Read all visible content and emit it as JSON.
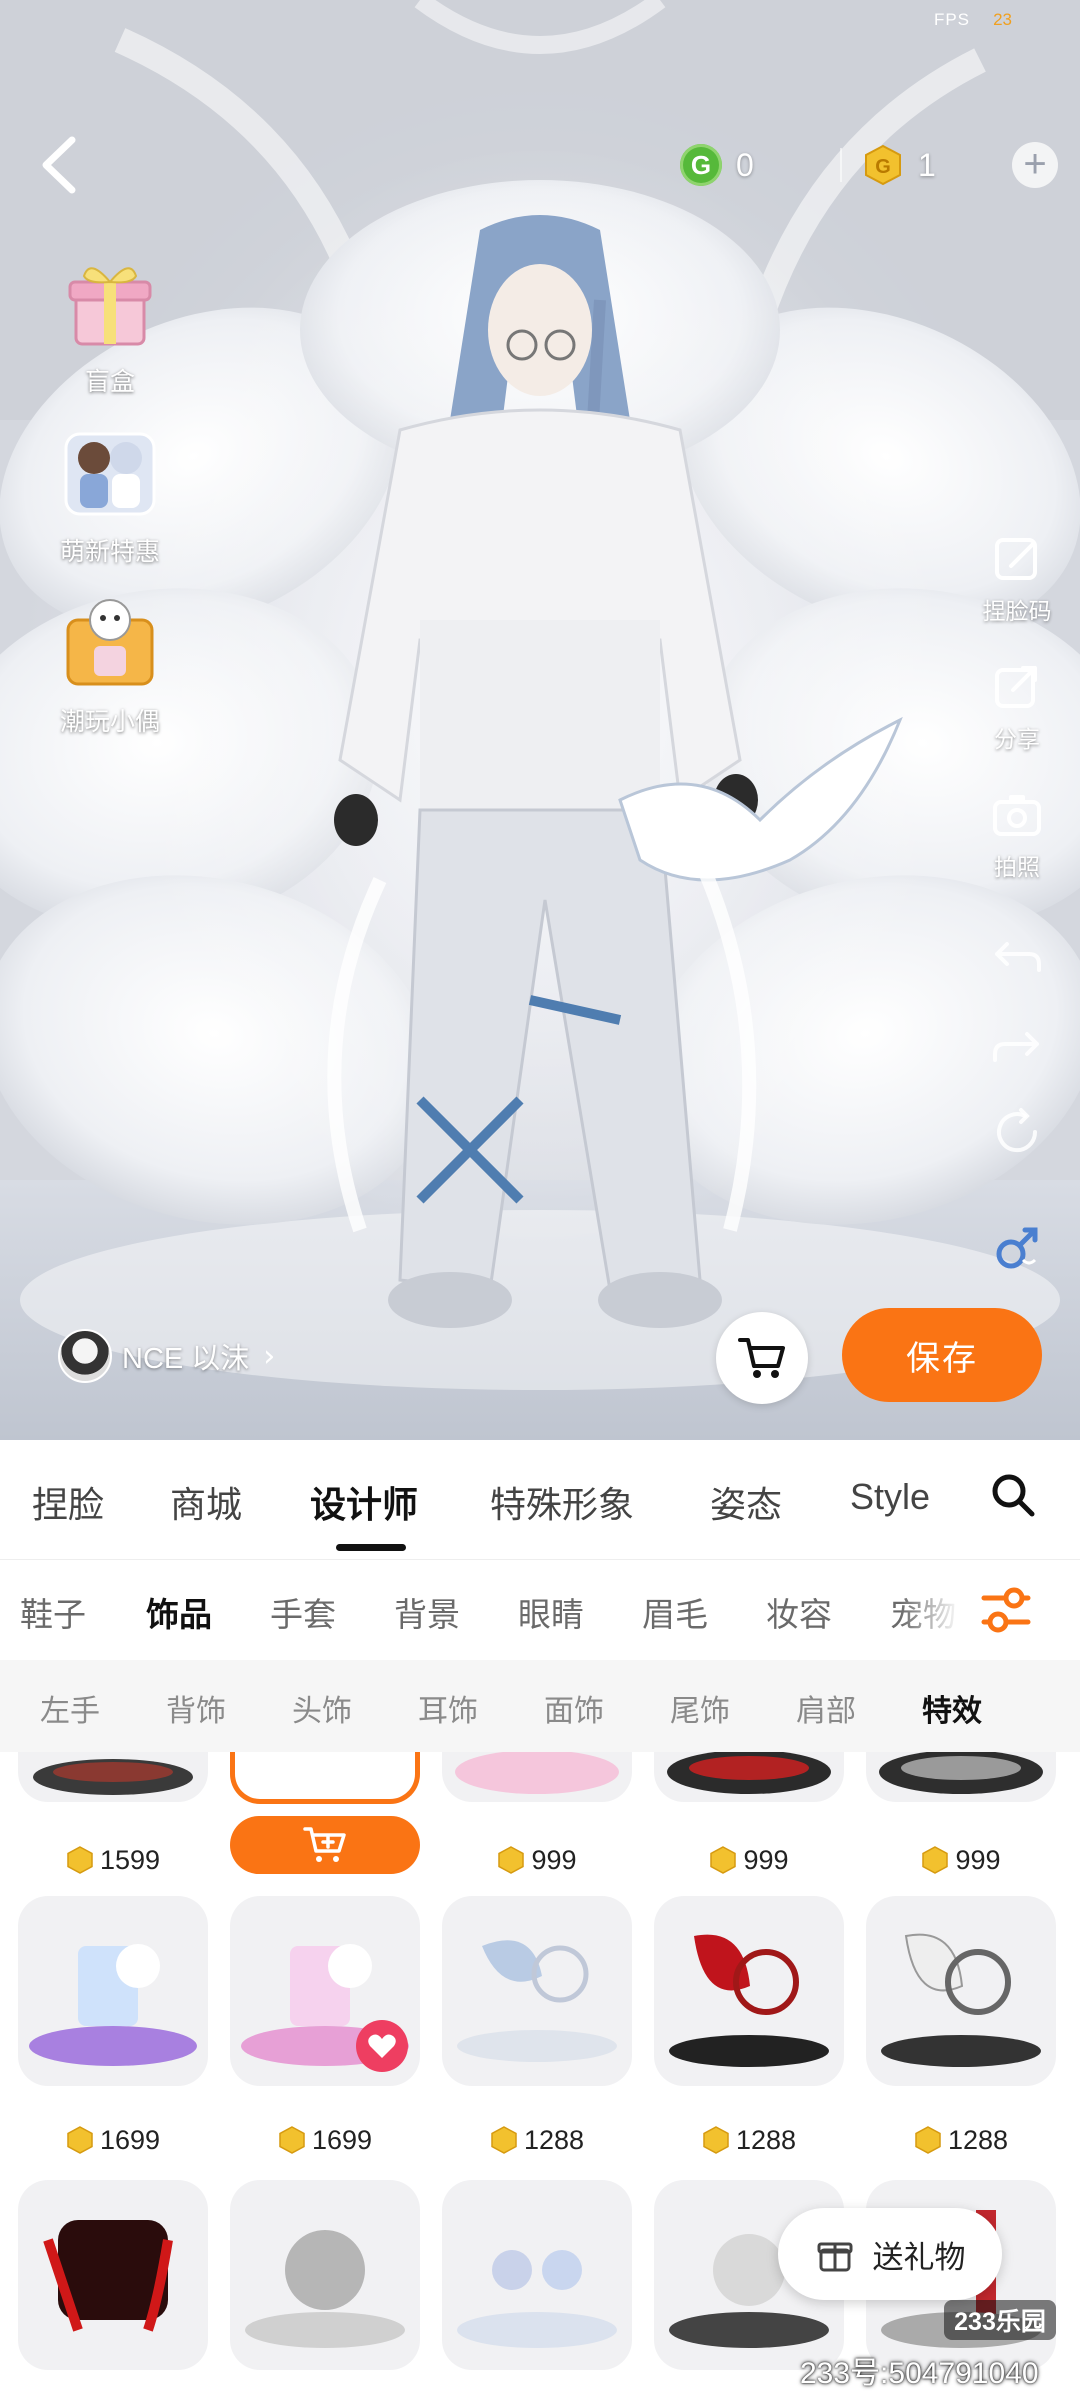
{
  "status": {
    "fps_label": "FPS",
    "fps_value": "23"
  },
  "currency": [
    {
      "icon": "g-coin-icon",
      "value": "0"
    },
    {
      "icon": "gold-coin-icon",
      "value": "1"
    }
  ],
  "left_menu": [
    {
      "label": "盲盒",
      "icon": "gift-box-icon"
    },
    {
      "label": "萌新特惠",
      "icon": "newbie-deal-icon"
    },
    {
      "label": "潮玩小偶",
      "icon": "toy-figure-icon"
    }
  ],
  "right_tools": [
    {
      "label": "捏脸码",
      "icon": "face-code-icon"
    },
    {
      "label": "分享",
      "icon": "share-icon"
    },
    {
      "label": "拍照",
      "icon": "camera-icon"
    },
    {
      "label": "",
      "icon": "undo-icon"
    },
    {
      "label": "",
      "icon": "redo-icon"
    },
    {
      "label": "",
      "icon": "reset-icon"
    },
    {
      "label": "",
      "icon": "gender-switch-icon"
    }
  ],
  "author": {
    "name": "NCE 以沫",
    "chevron": "›"
  },
  "actions": {
    "save_label": "保存"
  },
  "main_tabs": [
    "捏脸",
    "商城",
    "设计师",
    "特殊形象",
    "姿态",
    "Style"
  ],
  "main_tab_active": "设计师",
  "sub_tabs": [
    "鞋子",
    "饰品",
    "手套",
    "背景",
    "眼睛",
    "眉毛",
    "妆容",
    "宠物"
  ],
  "sub_tab_active": "饰品",
  "third_tabs": [
    "左手",
    "背饰",
    "头饰",
    "耳饰",
    "面饰",
    "尾饰",
    "肩部",
    "特效"
  ],
  "third_tab_active": "特效",
  "items_row1": [
    "1599",
    "",
    "999",
    "999",
    "999"
  ],
  "items_row2": [
    "1699",
    "1699",
    "1288",
    "1288",
    "1288"
  ],
  "items_row3": [
    "",
    "",
    "",
    "",
    ""
  ],
  "gift": {
    "label": "送礼物"
  },
  "watermark": {
    "logo": "233乐园",
    "id": "233号:504791040"
  },
  "colors": {
    "accent": "#fa7414",
    "favorite": "#ee3e61",
    "coin": "#f2c12e"
  }
}
